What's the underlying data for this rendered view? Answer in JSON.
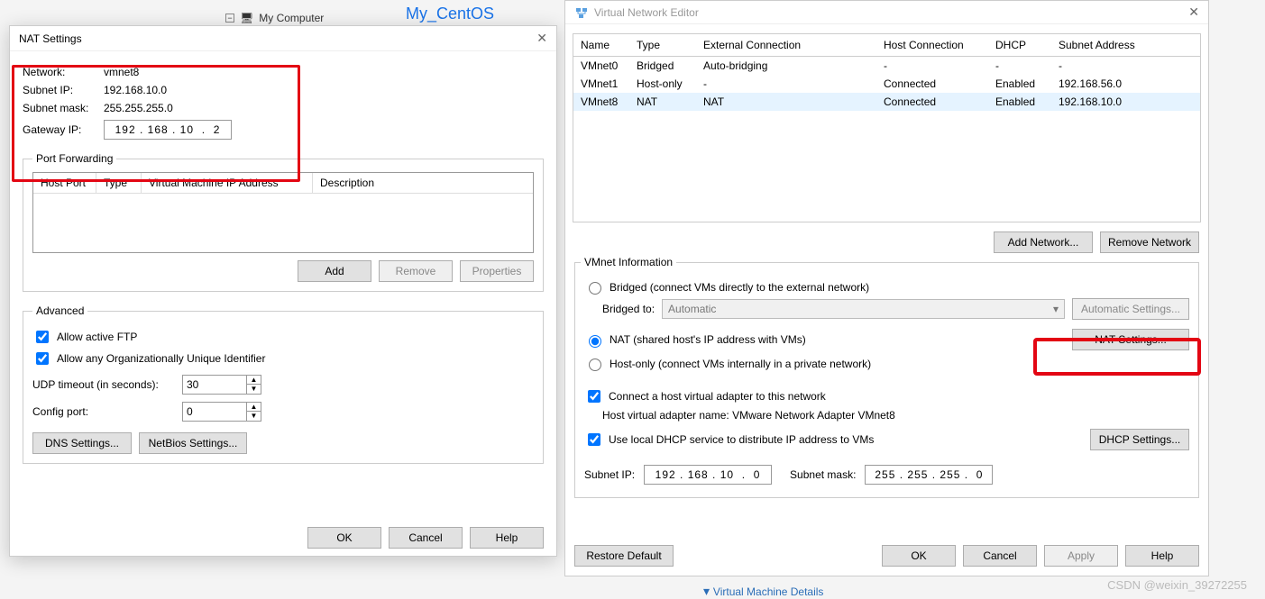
{
  "bg": {
    "my_computer": "My Computer",
    "tab": "My_CentOS"
  },
  "nat": {
    "title": "NAT Settings",
    "network_lbl": "Network:",
    "network_val": "vmnet8",
    "subnet_ip_lbl": "Subnet IP:",
    "subnet_ip_val": "192.168.10.0",
    "subnet_mask_lbl": "Subnet mask:",
    "subnet_mask_val": "255.255.255.0",
    "gateway_ip_lbl": "Gateway IP:",
    "gateway_ip_val": "192 . 168 . 10  .  2",
    "pf_legend": "Port Forwarding",
    "pf_cols": {
      "host": "Host Port",
      "type": "Type",
      "vmip": "Virtual Machine IP Address",
      "desc": "Description"
    },
    "btn_add": "Add",
    "btn_remove": "Remove",
    "btn_properties": "Properties",
    "adv_legend": "Advanced",
    "allow_ftp": "Allow active FTP",
    "allow_oui": "Allow any Organizationally Unique Identifier",
    "udp_lbl": "UDP timeout (in seconds):",
    "udp_val": "30",
    "cfg_port_lbl": "Config port:",
    "cfg_port_val": "0",
    "dns_btn": "DNS Settings...",
    "netbios_btn": "NetBios Settings...",
    "ok": "OK",
    "cancel": "Cancel",
    "help": "Help"
  },
  "vne": {
    "title": "Virtual Network Editor",
    "cols": {
      "name": "Name",
      "type": "Type",
      "ext": "External Connection",
      "host": "Host Connection",
      "dhcp": "DHCP",
      "sub": "Subnet Address"
    },
    "rows": [
      {
        "name": "VMnet0",
        "type": "Bridged",
        "ext": "Auto-bridging",
        "host": "-",
        "dhcp": "-",
        "sub": "-"
      },
      {
        "name": "VMnet1",
        "type": "Host-only",
        "ext": "-",
        "host": "Connected",
        "dhcp": "Enabled",
        "sub": "192.168.56.0"
      },
      {
        "name": "VMnet8",
        "type": "NAT",
        "ext": "NAT",
        "host": "Connected",
        "dhcp": "Enabled",
        "sub": "192.168.10.0"
      }
    ],
    "add_net": "Add Network...",
    "rem_net": "Remove Network",
    "info_legend": "VMnet Information",
    "bridged_radio": "Bridged (connect VMs directly to the external network)",
    "bridged_to_lbl": "Bridged to:",
    "bridged_to_val": "Automatic",
    "auto_settings": "Automatic Settings...",
    "nat_radio": "NAT (shared host's IP address with VMs)",
    "nat_settings": "NAT Settings...",
    "hostonly_radio": "Host-only (connect VMs internally in a private network)",
    "connect_adapter": "Connect a host virtual adapter to this network",
    "adapter_name_lbl": "Host virtual adapter name: VMware Network Adapter VMnet8",
    "use_dhcp": "Use local DHCP service to distribute IP address to VMs",
    "dhcp_settings": "DHCP Settings...",
    "subnet_ip_lbl": "Subnet IP:",
    "subnet_ip_val": "192 . 168 . 10  .  0",
    "subnet_mask_lbl": "Subnet mask:",
    "subnet_mask_val": "255 . 255 . 255 .  0",
    "restore": "Restore Default",
    "ok": "OK",
    "cancel": "Cancel",
    "apply": "Apply",
    "help": "Help"
  },
  "watermark": "CSDN @weixin_39272255",
  "vm_details": "Virtual Machine Details"
}
